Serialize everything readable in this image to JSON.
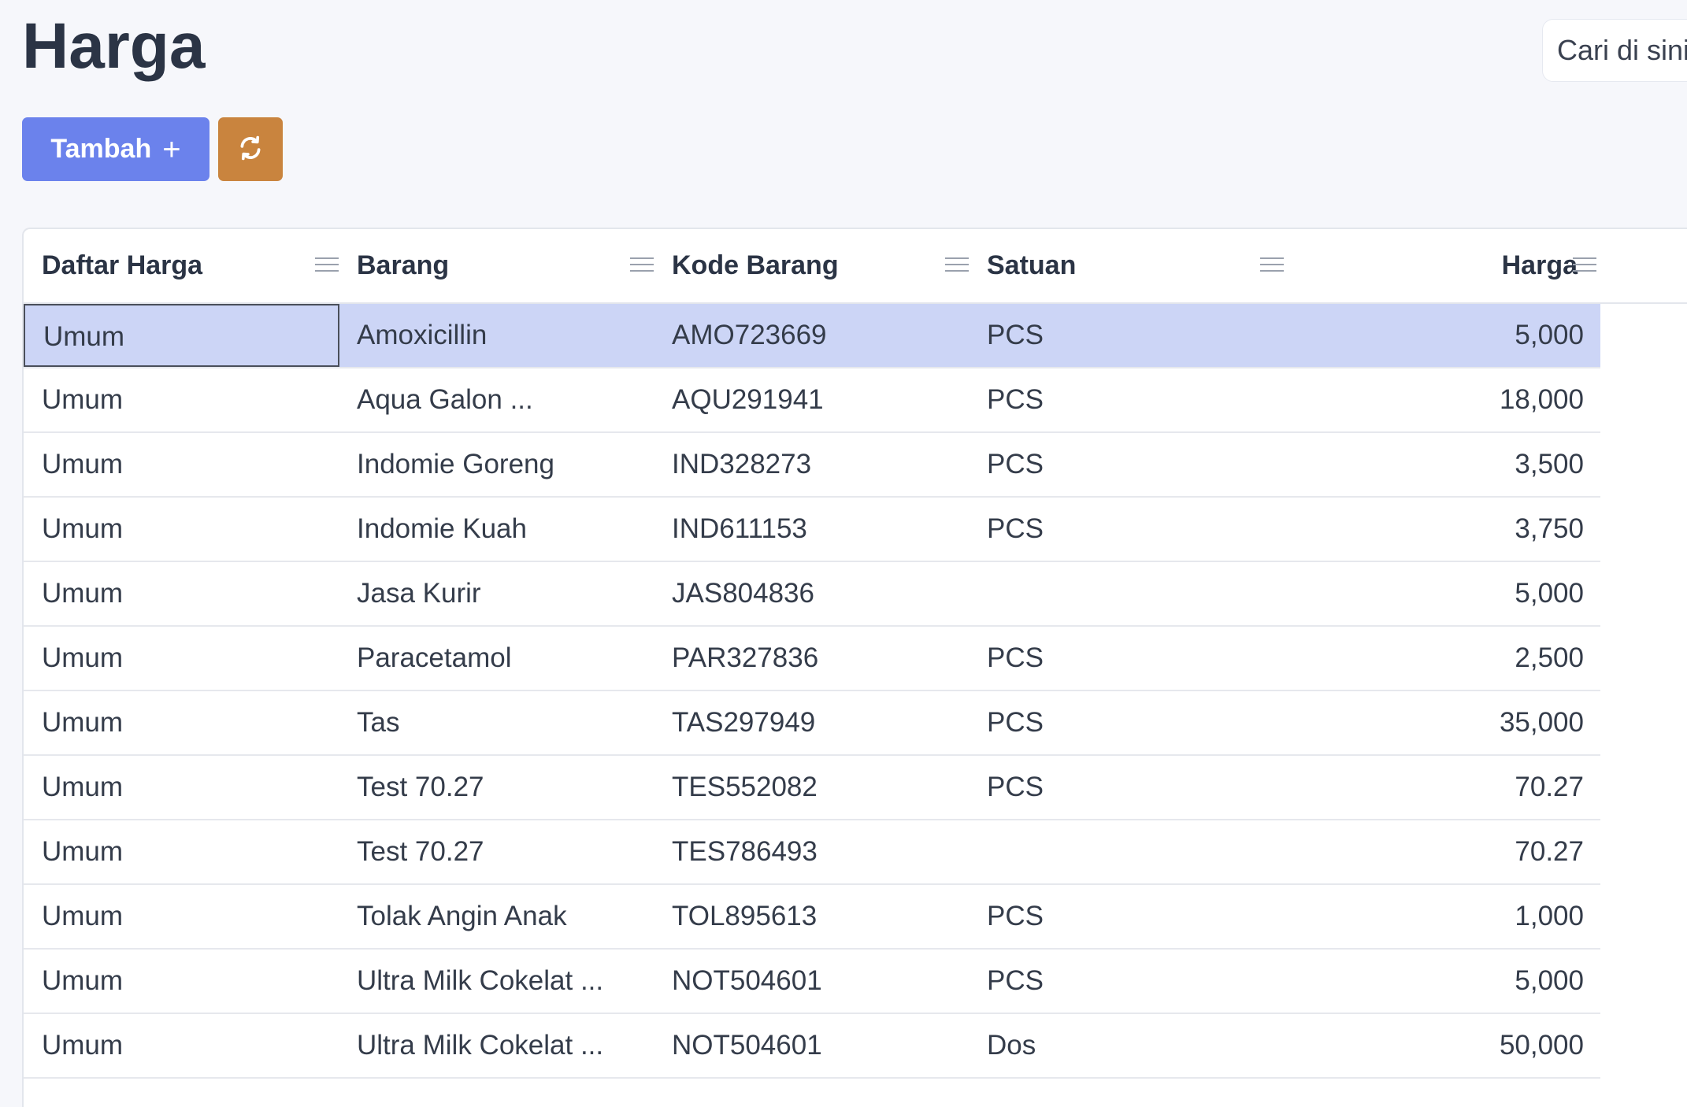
{
  "page": {
    "title": "Harga"
  },
  "search": {
    "placeholder": "Cari di sini"
  },
  "toolbar": {
    "add_label": "Tambah",
    "add_icon": "plus-icon",
    "refresh_icon": "refresh-icon"
  },
  "colors": {
    "primary": "#6b82ec",
    "refresh": "#c9843e",
    "selected_row": "#ccd5f6"
  },
  "table": {
    "columns": [
      "Daftar Harga",
      "Barang",
      "Kode Barang",
      "Satuan",
      "Harga"
    ],
    "rows": [
      [
        "Umum",
        "Amoxicillin",
        "AMO723669",
        "PCS",
        "5,000"
      ],
      [
        "Umum",
        "Aqua Galon ...",
        "AQU291941",
        "PCS",
        "18,000"
      ],
      [
        "Umum",
        "Indomie Goreng",
        "IND328273",
        "PCS",
        "3,500"
      ],
      [
        "Umum",
        "Indomie Kuah",
        "IND611153",
        "PCS",
        "3,750"
      ],
      [
        "Umum",
        "Jasa Kurir",
        "JAS804836",
        "",
        "5,000"
      ],
      [
        "Umum",
        "Paracetamol",
        "PAR327836",
        "PCS",
        "2,500"
      ],
      [
        "Umum",
        "Tas",
        "TAS297949",
        "PCS",
        "35,000"
      ],
      [
        "Umum",
        "Test 70.27",
        "TES552082",
        "PCS",
        "70.27"
      ],
      [
        "Umum",
        "Test 70.27",
        "TES786493",
        "",
        "70.27"
      ],
      [
        "Umum",
        "Tolak Angin Anak",
        "TOL895613",
        "PCS",
        "1,000"
      ],
      [
        "Umum",
        "Ultra Milk Cokelat ...",
        "NOT504601",
        "PCS",
        "5,000"
      ],
      [
        "Umum",
        "Ultra Milk Cokelat ...",
        "NOT504601",
        "Dos",
        "50,000"
      ]
    ]
  }
}
